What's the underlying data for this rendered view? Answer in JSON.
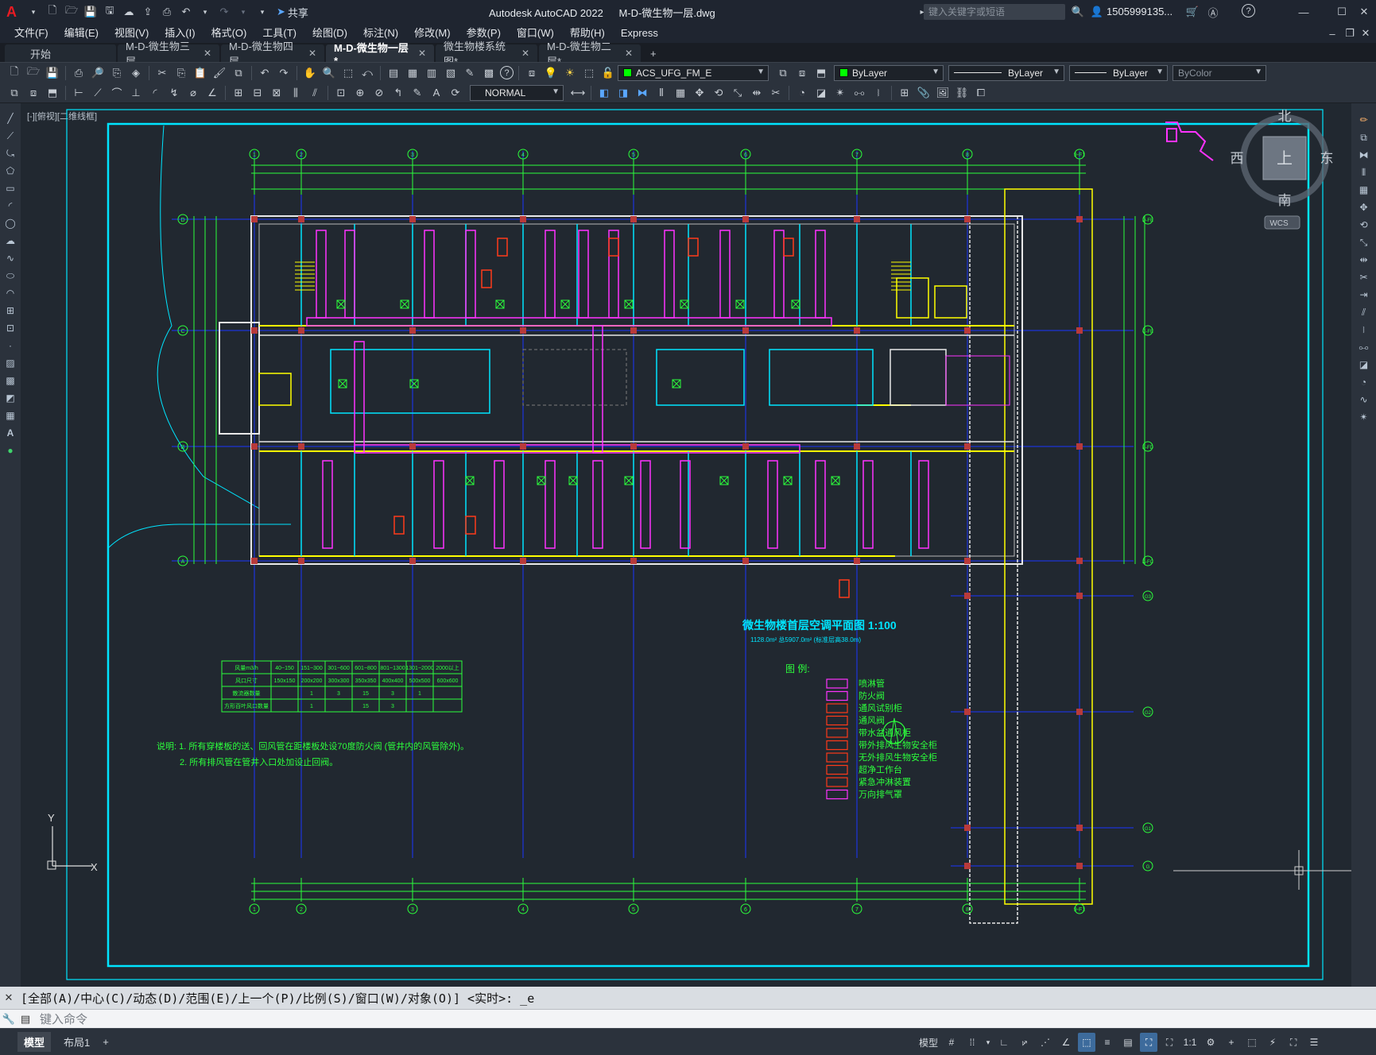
{
  "title_bar": {
    "app_title": "Autodesk AutoCAD 2022",
    "document": "M-D-微生物一层.dwg",
    "share_label": "共享",
    "search_placeholder": "键入关键字或短语",
    "username": "1505999135..."
  },
  "menu": [
    "文件(F)",
    "编辑(E)",
    "视图(V)",
    "插入(I)",
    "格式(O)",
    "工具(T)",
    "绘图(D)",
    "标注(N)",
    "修改(M)",
    "参数(P)",
    "窗口(W)",
    "帮助(H)",
    "Express"
  ],
  "tabs": [
    {
      "label": "开始",
      "active": false
    },
    {
      "label": "M-D-微生物三层",
      "active": false
    },
    {
      "label": "M-D-微生物四层",
      "active": false
    },
    {
      "label": "M-D-微生物一层*",
      "active": true
    },
    {
      "label": "微生物楼系统图*",
      "active": false
    },
    {
      "label": "M-D-微生物二层*",
      "active": false
    }
  ],
  "toolbar": {
    "layer": "ACS_UFG_FM_E",
    "color": "ByLayer",
    "linetype": "ByLayer",
    "lineweight": "ByLayer",
    "plotstyle": "ByColor",
    "textstyle": "NORMAL"
  },
  "viewport": {
    "label": "[-][俯视][二维线框]",
    "viewcube": {
      "n": "北",
      "s": "南",
      "e": "东",
      "w": "西",
      "top": "上",
      "wcs": "WCS"
    }
  },
  "drawing": {
    "grid_top": [
      "1",
      "2",
      "3",
      "4",
      "5",
      "6",
      "7",
      "8",
      "9-F1"
    ],
    "grid_left": [
      "D",
      "C",
      "B",
      "A"
    ],
    "grid_right": [
      "D-FE",
      "C-FE",
      "B-FD",
      "A-FC",
      "G3",
      "G2",
      "G1",
      "G"
    ],
    "plan_title": "微生物楼首层空调平面图  1:100",
    "plan_subtitle": "1128.0m² 总5907.0m² (标准层高38.0m)",
    "legend_title": "图 例:",
    "legend_items": [
      "喷淋管",
      "防火阀",
      "通风试别柜",
      "通风阀",
      "带水盆通风柜",
      "带外排风生物安全柜",
      "无外排风生物安全柜",
      "超净工作台",
      "紧急冲淋装置",
      "万向排气罩"
    ],
    "table": {
      "headers": [
        "风量m3/h",
        "40~150",
        "151~300",
        "301~600",
        "601~800",
        "801~1300",
        "1301~2000",
        "2000以上"
      ],
      "rows": [
        [
          "风口尺寸",
          "150x150",
          "200x200",
          "300x300",
          "350x350",
          "400x400",
          "500x500",
          "600x600"
        ],
        [
          "散流器数量",
          "",
          "1",
          "3",
          "15",
          "3",
          "1",
          ""
        ],
        [
          "方形百叶风口数量",
          "",
          "1",
          "",
          "15",
          "3",
          "",
          ""
        ]
      ]
    },
    "notes": [
      "说明: 1. 所有穿楼板的送、回风管在距楼板处设70度防火阀 (管井内的风管除外)。",
      "2. 所有排风管在管井入口处加设止回阀。"
    ]
  },
  "command": {
    "history": "[全部(A)/中心(C)/动态(D)/范围(E)/上一个(P)/比例(S)/窗口(W)/对象(O)] <实时>: _e",
    "placeholder": "键入命令"
  },
  "status": {
    "tabs": [
      "模型",
      "布局1"
    ],
    "model_label": "模型",
    "scale": "1:1"
  },
  "colors": {
    "bg": "#212830",
    "border_cyan": "#00e5ff",
    "grid_blue": "#1b36ff",
    "wall_white": "#e8e8e8",
    "duct_magenta": "#ff33ff",
    "dim_green": "#2cff3c",
    "yellow": "#ffff00",
    "red": "#ff3a1a"
  }
}
